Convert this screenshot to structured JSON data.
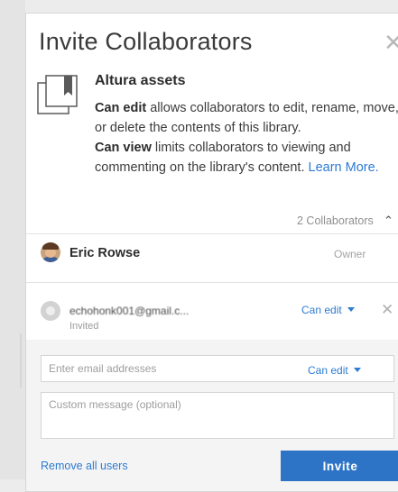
{
  "dialog": {
    "title": "Invite Collaborators",
    "close_icon": "close-icon"
  },
  "library": {
    "icon": "library-icon",
    "name": "Altura assets",
    "can_edit_label": "Can edit",
    "can_edit_text": " allows collaborators to edit, rename, move, or delete the contents of this library.",
    "can_view_label": "Can view",
    "can_view_text": " limits collaborators to viewing and commenting on the library's content. ",
    "learn_more": "Learn More."
  },
  "collaborators": {
    "count_label": "2 Collaborators",
    "toggle_icon": "chevron-up-icon",
    "owner": {
      "name": "Eric Rowse",
      "role": "Owner"
    },
    "invitee": {
      "email": "echohonk001@gmail.c...",
      "status": "Invited",
      "permission": "Can edit",
      "remove_icon": "close-icon"
    }
  },
  "form": {
    "email_placeholder": "Enter email addresses",
    "permission": "Can edit",
    "message_placeholder": "Custom message (optional)",
    "remove_all": "Remove all users",
    "invite": "Invite"
  },
  "colors": {
    "accent": "#2d74c6",
    "link": "#2d7bd3"
  }
}
